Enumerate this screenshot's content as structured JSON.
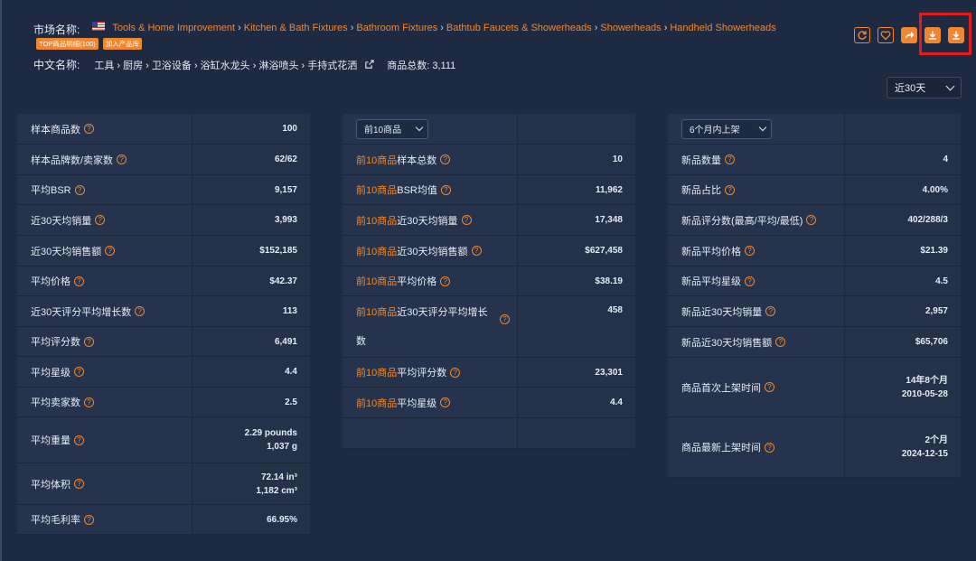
{
  "header": {
    "market_label": "市场名称:",
    "breadcrumbs": [
      "Tools & Home Improvement",
      "Kitchen & Bath Fixtures",
      "Bathroom Fixtures",
      "Bathtub Faucets & Showerheads",
      "Showerheads",
      "Handheld Showerheads"
    ],
    "badge_top": "TOP商品明细(100)",
    "badge_add": "加入产品库",
    "cn_label": "中文名称:",
    "cn_name": "工具 › 厨房 › 卫浴设备 › 浴缸水龙头 › 淋浴喷头 › 手持式花洒",
    "total_label": "商品总数:",
    "total_value": "3,111"
  },
  "actions": [
    "refresh-icon",
    "heart-icon",
    "share-icon",
    "download-icon",
    "download-icon"
  ],
  "period_select": "近30天",
  "table1": {
    "rows": [
      {
        "k": "样本商品数",
        "v": "100"
      },
      {
        "k": "样本品牌数/卖家数",
        "v": "62/62"
      },
      {
        "k": "平均BSR",
        "v": "9,157"
      },
      {
        "k": "近30天均销量",
        "v": "3,993"
      },
      {
        "k": "近30天均销售额",
        "v": "$152,185"
      },
      {
        "k": "平均价格",
        "v": "$42.37"
      },
      {
        "k": "近30天评分平均增长数",
        "v": "113"
      },
      {
        "k": "平均评分数",
        "v": "6,491"
      },
      {
        "k": "平均星级",
        "v": "4.4"
      },
      {
        "k": "平均卖家数",
        "v": "2.5"
      },
      {
        "k": "平均重量",
        "v": "2.29 pounds",
        "v2": "1,037 g"
      },
      {
        "k": "平均体积",
        "v": "72.14 in³",
        "v2": "1,182 cm³"
      },
      {
        "k": "平均毛利率",
        "v": "66.95%"
      }
    ]
  },
  "table2": {
    "select": "前10商品",
    "prefix": "前10商品",
    "rows": [
      {
        "k": "样本总数",
        "v": "10"
      },
      {
        "k": "BSR均值",
        "v": "11,962"
      },
      {
        "k": "近30天均销量",
        "v": "17,348"
      },
      {
        "k": "近30天均销售额",
        "v": "$627,458"
      },
      {
        "k": "平均价格",
        "v": "$38.19"
      },
      {
        "k": "近30天评分平均增长",
        "k2": "数",
        "v": "458"
      },
      {
        "k": "平均评分数",
        "v": "23,301"
      },
      {
        "k": "平均星级",
        "v": "4.4"
      }
    ]
  },
  "table3": {
    "select": "6个月内上架",
    "rows": [
      {
        "k": "新品数量",
        "v": "4"
      },
      {
        "k": "新品占比",
        "v": "4.00%"
      },
      {
        "k": "新品评分数(最高/平均/最低)",
        "v": "402/288/3"
      },
      {
        "k": "新品平均价格",
        "v": "$21.39"
      },
      {
        "k": "新品平均星级",
        "v": "4.5"
      },
      {
        "k": "新品近30天均销量",
        "v": "2,957"
      },
      {
        "k": "新品近30天均销售额",
        "v": "$65,706"
      },
      {
        "k": "商品首次上架时间",
        "v": "14年8个月",
        "v2": "2010-05-28"
      },
      {
        "k": "商品最新上架时间",
        "v": "2个月",
        "v2": "2024-12-15"
      }
    ]
  },
  "colors": {
    "accent": "#f0872f",
    "background": "#1d2a41",
    "highlight": "#e11c1c"
  }
}
